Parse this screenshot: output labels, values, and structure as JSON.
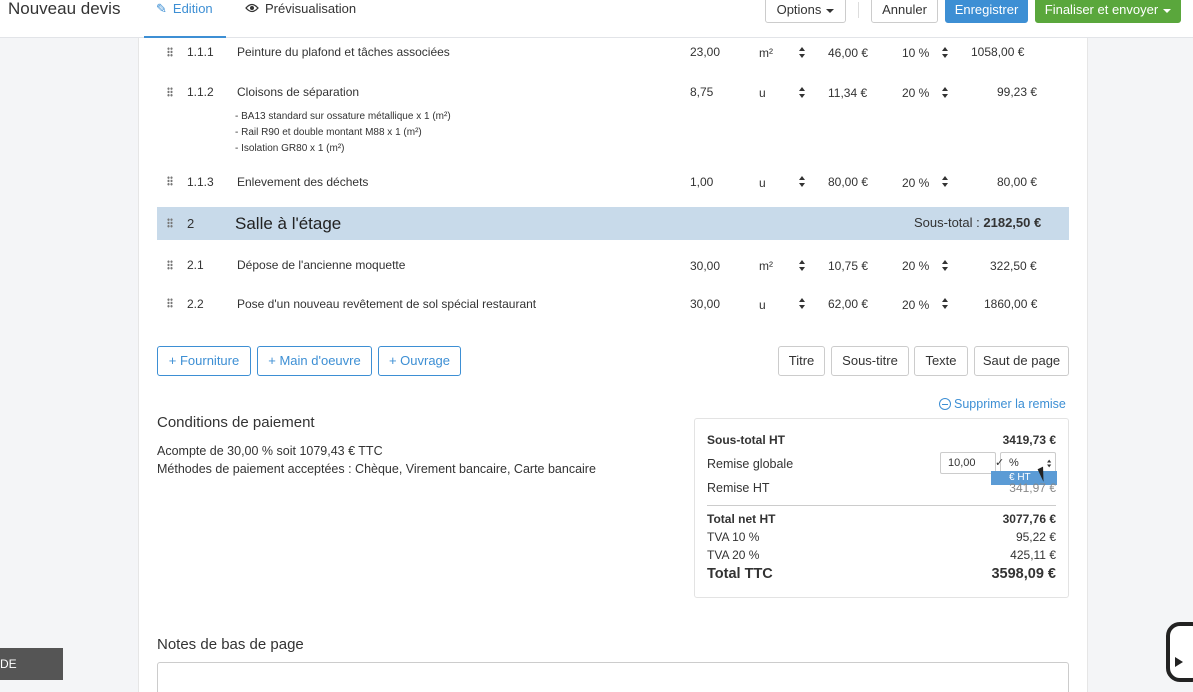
{
  "topbar": {
    "title": "Nouveau devis",
    "tab_edit": "Edition",
    "tab_preview": "Prévisualisation",
    "options": "Options",
    "cancel": "Annuler",
    "save": "Enregistrer",
    "finalize": "Finaliser et envoyer"
  },
  "lines": [
    {
      "num": "1.1.1",
      "label": "Peinture du plafond et tâches associées",
      "qty": "23,00",
      "unit": "m²",
      "price": "46,00 €",
      "vat": "10 %",
      "total": "1058,00 €"
    },
    {
      "num": "1.1.2",
      "label": "Cloisons de séparation",
      "qty": "8,75",
      "unit": "u",
      "price": "11,34 €",
      "vat": "20 %",
      "total": "99,23 €",
      "details": [
        "- BA13 standard sur ossature métallique x 1 (m²)",
        "- Rail R90 et double montant M88 x 1 (m²)",
        "- Isolation GR80 x 1 (m²)"
      ]
    },
    {
      "num": "1.1.3",
      "label": "Enlevement des déchets",
      "qty": "1,00",
      "unit": "u",
      "price": "80,00 €",
      "vat": "20 %",
      "total": "80,00 €"
    },
    {
      "num": "2.1",
      "label": "Dépose de l'ancienne moquette",
      "qty": "30,00",
      "unit": "m²",
      "price": "10,75 €",
      "vat": "20 %",
      "total": "322,50 €"
    },
    {
      "num": "2.2",
      "label": "Pose d'un nouveau revêtement de sol spécial restaurant",
      "qty": "30,00",
      "unit": "u",
      "price": "62,00 €",
      "vat": "20 %",
      "total": "1860,00 €"
    }
  ],
  "section": {
    "num": "2",
    "title": "Salle à l'étage",
    "subtotal_label": "Sous-total :",
    "subtotal_value": "2182,50 €"
  },
  "actions": {
    "fourniture": "+ Fourniture",
    "main_oeuvre": "+ Main d'oeuvre",
    "ouvrage": "+ Ouvrage",
    "titre": "Titre",
    "sous_titre": "Sous-titre",
    "texte": "Texte",
    "saut": "Saut de page"
  },
  "payment": {
    "heading": "Conditions de paiement",
    "line1": "Acompte de 30,00 % soit 1079,43 € TTC",
    "line2": "Méthodes de paiement acceptées : Chèque, Virement bancaire, Carte bancaire"
  },
  "totals": {
    "remove_discount": "Supprimer la remise",
    "subtotal_label": "Sous-total HT",
    "subtotal_value": "3419,73 €",
    "global_discount_label": "Remise globale",
    "discount_input": "10,00",
    "discount_unit": "%",
    "dropdown_option": "€ HT",
    "discount_ht_label": "Remise HT",
    "discount_ht_value": "341,97 €",
    "net_label": "Total net HT",
    "net_value": "3077,76 €",
    "vat10_label": "TVA 10 %",
    "vat10_value": "95,22 €",
    "vat20_label": "TVA 20 %",
    "vat20_value": "425,11 €",
    "ttc_label": "Total TTC",
    "ttc_value": "3598,09 €"
  },
  "notes": {
    "heading": "Notes de bas de page"
  },
  "videos": {
    "label": "DE VIDÉOS"
  },
  "colors": {
    "accent": "#3d8fd4",
    "success": "#5aa73c",
    "section_bg": "#c8daea"
  }
}
